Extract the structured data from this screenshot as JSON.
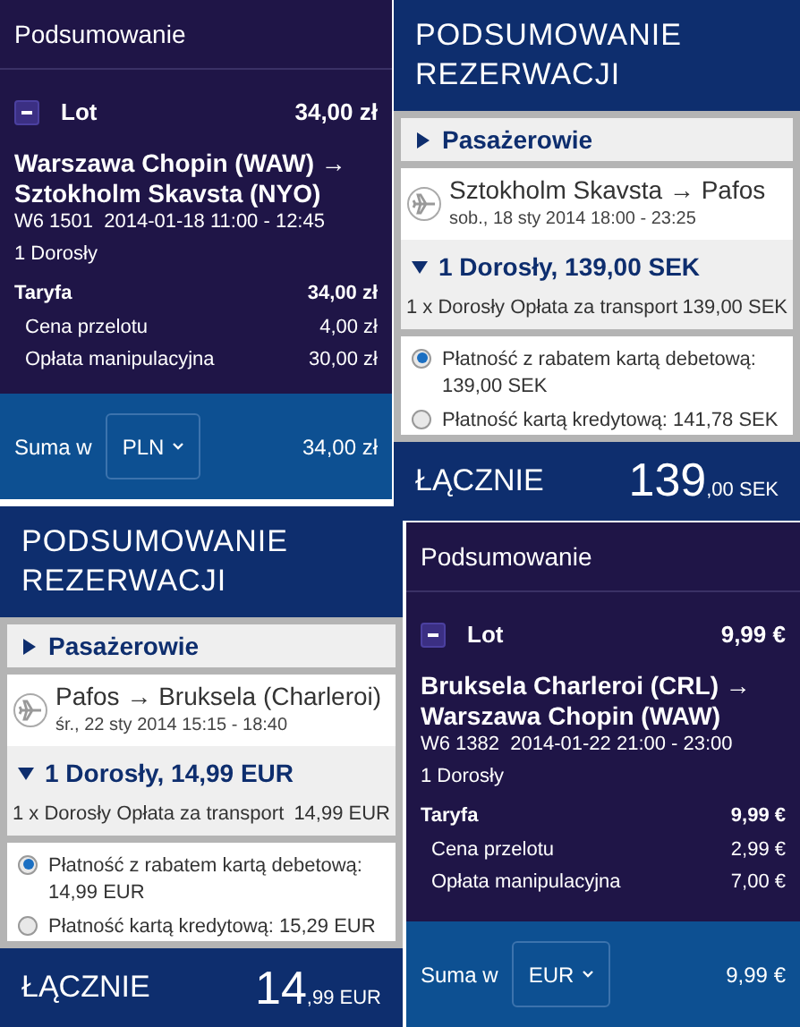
{
  "panels": [
    {
      "kind": "summary",
      "title": "Podsumowanie",
      "lot": {
        "label": "Lot",
        "price": "34,00 zł",
        "expanded": true
      },
      "route": [
        "Warszawa Chopin (WAW) →",
        "Sztokholm Skavsta (NYO)"
      ],
      "flight_info": "W6 1501  2014-01-18 11:00 - 12:45",
      "passengers": "1 Dorosły",
      "fare": {
        "label": "Taryfa",
        "amount": "34,00 zł",
        "items": [
          {
            "label": "Cena przelotu",
            "amount": "4,00 zł"
          },
          {
            "label": "Opłata manipulacyjna",
            "amount": "30,00 zł"
          }
        ]
      },
      "total": {
        "label": "Suma w",
        "currency": "PLN",
        "amount": "34,00 zł"
      }
    },
    {
      "kind": "reservation",
      "title": "PODSUMOWANIE REZERWACJI",
      "section": {
        "label": "Pasażerowie",
        "expanded": false
      },
      "flight": {
        "route": "Sztokholm Skavsta → Pafos",
        "date": "sob., 18 sty 2014 18:00 - 23:25"
      },
      "passenger": {
        "header": "1 Dorosły, 139,00 SEK",
        "expanded": true,
        "line_label": "1 x Dorosły Opłata za transport",
        "line_amount": "139,00 SEK"
      },
      "payment_options": [
        {
          "label": "Płatność z rabatem kartą debetową: 139,00 SEK",
          "selected": true
        },
        {
          "label": "Płatność kartą kredytową: 141,78 SEK",
          "selected": false
        }
      ],
      "total": {
        "label": "ŁĄCZNIE",
        "whole": "139",
        "fraction": ",00",
        "currency": "SEK"
      }
    },
    {
      "kind": "reservation",
      "title": "PODSUMOWANIE REZERWACJI",
      "section": {
        "label": "Pasażerowie",
        "expanded": false
      },
      "flight": {
        "route": "Pafos → Bruksela (Charleroi)",
        "date": "śr., 22 sty 2014 15:15 - 18:40"
      },
      "passenger": {
        "header": "1 Dorosły, 14,99 EUR",
        "expanded": true,
        "line_label": "1 x Dorosły Opłata za transport",
        "line_amount": "14,99 EUR"
      },
      "payment_options": [
        {
          "label": "Płatność z rabatem kartą debetową: 14,99 EUR",
          "selected": true
        },
        {
          "label": "Płatność kartą kredytową: 15,29 EUR",
          "selected": false
        }
      ],
      "total": {
        "label": "ŁĄCZNIE",
        "whole": "14",
        "fraction": ",99",
        "currency": "EUR"
      }
    },
    {
      "kind": "summary",
      "title": "Podsumowanie",
      "lot": {
        "label": "Lot",
        "price": "9,99 €",
        "expanded": true
      },
      "route": [
        "Bruksela Charleroi (CRL) →",
        "Warszawa Chopin (WAW)"
      ],
      "flight_info": "W6 1382  2014-01-22 21:00 - 23:00",
      "passengers": "1 Dorosły",
      "fare": {
        "label": "Taryfa",
        "amount": "9,99 €",
        "items": [
          {
            "label": "Cena przelotu",
            "amount": "2,99 €"
          },
          {
            "label": "Opłata manipulacyjna",
            "amount": "7,00 €"
          }
        ]
      },
      "total": {
        "label": "Suma w",
        "currency": "EUR",
        "amount": "9,99 €"
      }
    }
  ]
}
